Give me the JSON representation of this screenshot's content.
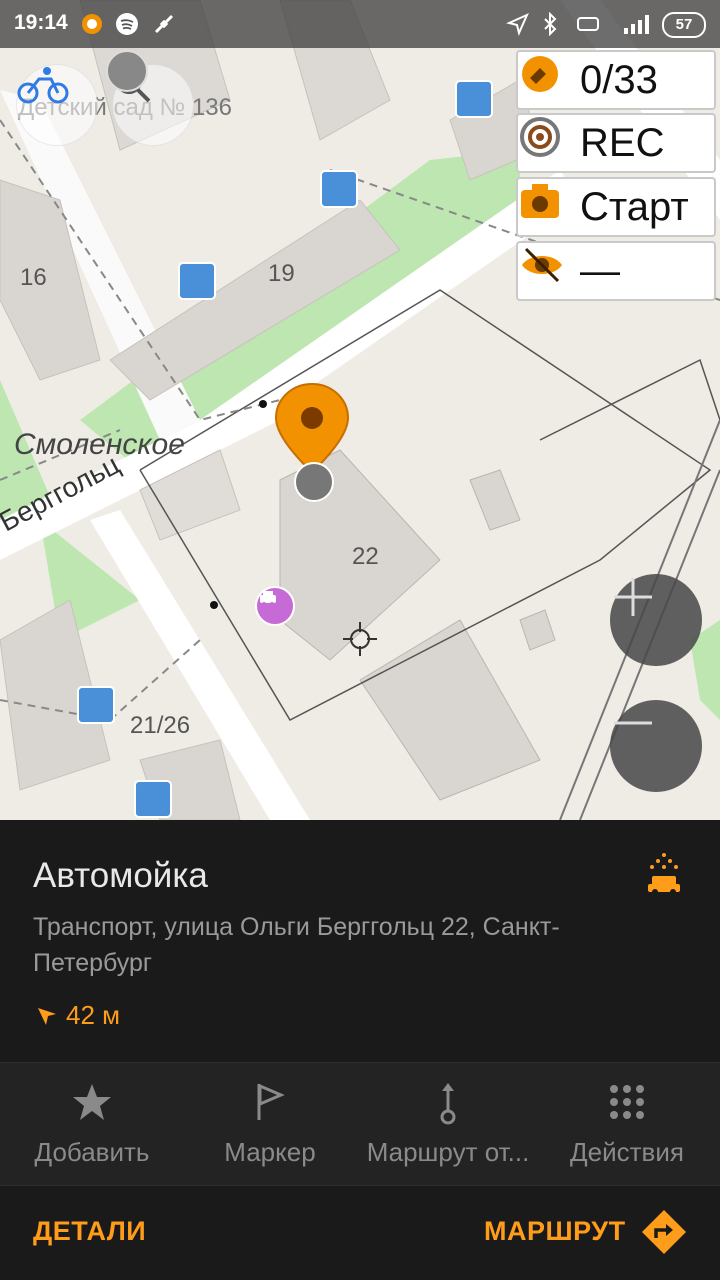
{
  "status": {
    "time": "19:14",
    "battery": "57"
  },
  "map": {
    "labels": {
      "kindergarten": "Детский сад № 136",
      "house16": "16",
      "house19": "19",
      "house22": "22",
      "house2126": "21/26",
      "district": "Смоленское",
      "street": "Берггольц"
    }
  },
  "widgets": {
    "gps": "0/33",
    "rec": "REC",
    "photo": "Старт",
    "visibility": "—"
  },
  "poi": {
    "title": "Автомойка",
    "address": "Транспорт, улица Ольги Берггольц 22, Санкт-Петербург",
    "distance": "42 м"
  },
  "actions": [
    {
      "label": "Добавить"
    },
    {
      "label": "Маркер"
    },
    {
      "label": "Маршрут от..."
    },
    {
      "label": "Действия"
    }
  ],
  "bottom": {
    "details": "ДЕТАЛИ",
    "route": "МАРШРУТ"
  },
  "colors": {
    "accent": "#ff9c1a",
    "panel": "#1a1a1a",
    "pin": "#f39200"
  }
}
